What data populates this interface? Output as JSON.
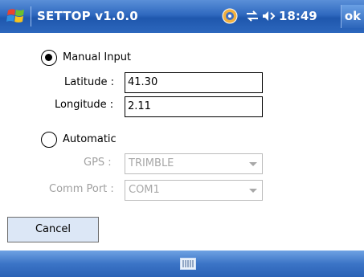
{
  "titlebar": {
    "title": "SETTOP v1.0.0",
    "time": "18:49",
    "ok_label": "ok",
    "icons": [
      "windows-start-icon",
      "gps-status-icon",
      "connectivity-icon",
      "volume-icon"
    ]
  },
  "form": {
    "manual": {
      "label": "Manual Input",
      "selected": true,
      "latitude_label": "Latitude :",
      "latitude_value": "41.30",
      "longitude_label": "Longitude :",
      "longitude_value": "2.11"
    },
    "automatic": {
      "label": "Automatic",
      "selected": false,
      "gps_label": "GPS :",
      "gps_value": "TRIMBLE",
      "comm_port_label": "Comm Port :",
      "comm_port_value": "COM1"
    }
  },
  "buttons": {
    "cancel_label": "Cancel"
  },
  "menubar": {
    "icon": "keyboard-icon"
  },
  "colors": {
    "titlebar_blue": "#2f69bf",
    "disabled_text": "#a0a0a0",
    "button_bg": "#dce7f6"
  }
}
